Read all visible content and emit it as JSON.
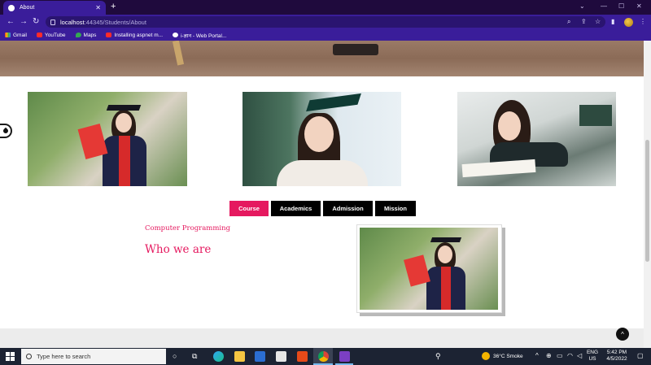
{
  "browser": {
    "tab_title": "About",
    "new_tab": "+",
    "url_host": "localhost",
    "url_path": ":44345/Students/About",
    "bookmarks": [
      {
        "label": "Gmail"
      },
      {
        "label": "YouTube"
      },
      {
        "label": "Maps"
      },
      {
        "label": "Installing aspnet m..."
      },
      {
        "label": "i-ज्ञान - Web Portal..."
      }
    ]
  },
  "page": {
    "tabs": [
      {
        "label": "Course",
        "active": true
      },
      {
        "label": "Academics",
        "active": false
      },
      {
        "label": "Admission",
        "active": false
      },
      {
        "label": "Mission",
        "active": false
      }
    ],
    "subtitle": "Computer Programming",
    "heading": "Who we are",
    "accent_color": "#e5195f"
  },
  "taskbar": {
    "search_placeholder": "Type here to search",
    "weather": "36°C Smoke",
    "lang_top": "ENG",
    "lang_bottom": "US",
    "time": "5:42 PM",
    "date": "4/5/2022"
  }
}
